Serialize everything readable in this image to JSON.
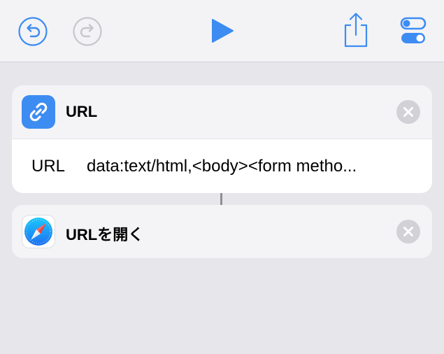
{
  "colors": {
    "accent": "#3d8cf2",
    "background": "#e6e6eb",
    "toolbar": "#f3f3f6",
    "card": "#ffffff"
  },
  "toolbar": {
    "undo_icon": "undo-icon",
    "redo_icon": "redo-icon",
    "play_icon": "play-icon",
    "share_icon": "share-icon",
    "toggles_icon": "settings-toggles-icon"
  },
  "actions": [
    {
      "icon": "link-icon",
      "title": "URL",
      "param_label": "URL",
      "param_value": "data:text/html,<body><form metho..."
    },
    {
      "icon": "safari-compass-icon",
      "title": "URLを開く"
    }
  ]
}
